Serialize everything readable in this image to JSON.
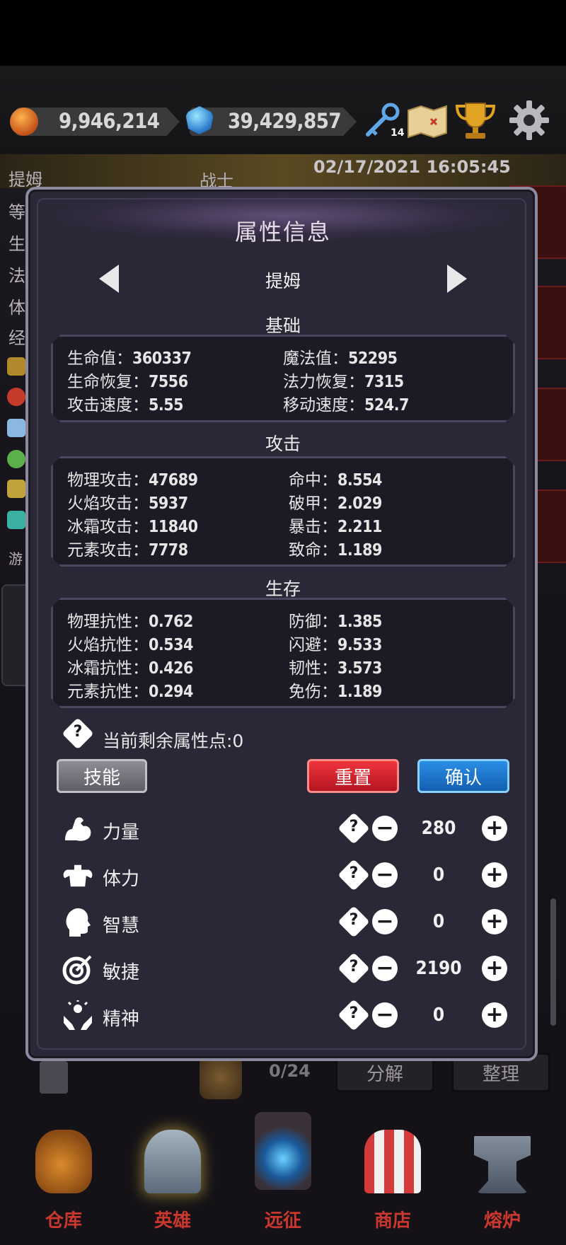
{
  "resources": {
    "gold": "9,946,214",
    "gems": "39,429,857",
    "keys_count": "14"
  },
  "background": {
    "hero_name": "提姆",
    "hero_class": "战士",
    "datetime": "02/17/2021 16:05:45",
    "side_labels": [
      "等",
      "生",
      "法",
      "体",
      "经",
      "游"
    ],
    "inventory_count": "0/24",
    "btn_decompose": "分解",
    "btn_sort": "整理"
  },
  "panel": {
    "title": "属性信息",
    "hero_name": "提姆"
  },
  "sections": {
    "basic": {
      "title": "基础",
      "stats": [
        {
          "label": "生命值：",
          "value": "360337"
        },
        {
          "label": "魔法值：",
          "value": "52295"
        },
        {
          "label": "生命恢复：",
          "value": "7556"
        },
        {
          "label": "法力恢复：",
          "value": "7315"
        },
        {
          "label": "攻击速度：",
          "value": "5.55"
        },
        {
          "label": "移动速度：",
          "value": "524.7"
        }
      ]
    },
    "attack": {
      "title": "攻击",
      "stats": [
        {
          "label": "物理攻击：",
          "value": "47689"
        },
        {
          "label": "命中：",
          "value": "8.554"
        },
        {
          "label": "火焰攻击：",
          "value": "5937"
        },
        {
          "label": "破甲：",
          "value": "2.029"
        },
        {
          "label": "冰霜攻击：",
          "value": "11840"
        },
        {
          "label": "暴击：",
          "value": "2.211"
        },
        {
          "label": "元素攻击：",
          "value": "7778"
        },
        {
          "label": "致命：",
          "value": "1.189"
        }
      ]
    },
    "survival": {
      "title": "生存",
      "stats": [
        {
          "label": "物理抗性：",
          "value": "0.762"
        },
        {
          "label": "防御：",
          "value": "1.385"
        },
        {
          "label": "火焰抗性：",
          "value": "0.534"
        },
        {
          "label": "闪避：",
          "value": "9.533"
        },
        {
          "label": "冰霜抗性：",
          "value": "0.426"
        },
        {
          "label": "韧性：",
          "value": "3.573"
        },
        {
          "label": "元素抗性：",
          "value": "0.294"
        },
        {
          "label": "免伤：",
          "value": "1.189"
        }
      ]
    }
  },
  "remaining_points": "当前剩余属性点:0",
  "buttons": {
    "skill": "技能",
    "reset": "重置",
    "confirm": "确认"
  },
  "attributes": [
    {
      "name": "力量",
      "value": "280",
      "icon": "muscle-arm-icon"
    },
    {
      "name": "体力",
      "value": "0",
      "icon": "torso-icon"
    },
    {
      "name": "智慧",
      "value": "0",
      "icon": "head-icon"
    },
    {
      "name": "敏捷",
      "value": "2190",
      "icon": "target-icon"
    },
    {
      "name": "精神",
      "value": "0",
      "icon": "spirit-hands-icon"
    }
  ],
  "nav": [
    {
      "label": "仓库",
      "icon": "sack-icon"
    },
    {
      "label": "英雄",
      "icon": "helmet-icon"
    },
    {
      "label": "远征",
      "icon": "portal-icon"
    },
    {
      "label": "商店",
      "icon": "shop-icon"
    },
    {
      "label": "熔炉",
      "icon": "anvil-icon"
    }
  ],
  "colors": {
    "panel_bg": "#2a2736",
    "reset_button": "#d9202a",
    "confirm_button": "#1f7ad6",
    "nav_label": "#c9372f"
  }
}
